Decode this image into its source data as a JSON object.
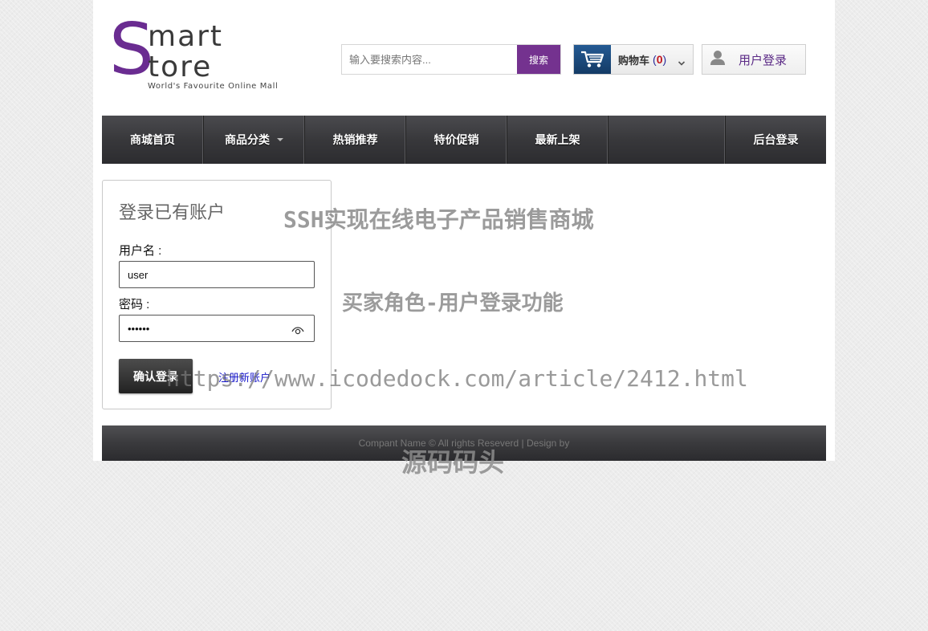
{
  "logo": {
    "big_letter": "S",
    "line1": "mart",
    "line2": "tore",
    "tagline": "World's Favourite Online Mall"
  },
  "search": {
    "placeholder": "输入要搜索内容...",
    "value": "",
    "button_label": "搜索"
  },
  "cart": {
    "label": "购物车",
    "count": "0",
    "icon": "shopping-cart-icon"
  },
  "header_login": {
    "label": "用户登录",
    "icon": "user-icon"
  },
  "nav": {
    "items": [
      {
        "label": "商城首页"
      },
      {
        "label": "商品分类"
      },
      {
        "label": "热销推荐"
      },
      {
        "label": "特价促销"
      },
      {
        "label": "最新上架"
      },
      {
        "label": "后台登录"
      }
    ]
  },
  "login_form": {
    "title": "登录已有账户",
    "username_label": "用户名 :",
    "username_value": "user",
    "password_label": "密码 :",
    "password_value": "123456",
    "submit_label": "确认登录",
    "register_link": "注册新账户"
  },
  "footer": {
    "text": "Compant Name © All rights Reseverd | Design by"
  },
  "watermarks": {
    "title": "SSH实现在线电子产品销售商城",
    "subtitle": "买家角色-用户登录功能",
    "url": "https://www.icodedock.com/article/2412.html",
    "brand": "源码码头"
  },
  "colors": {
    "brand_purple": "#74328f",
    "nav_dark": "#38383b",
    "cart_blue": "#1b4a7c",
    "link_blue": "#1414c8",
    "cart_count_red": "#c0141c"
  }
}
